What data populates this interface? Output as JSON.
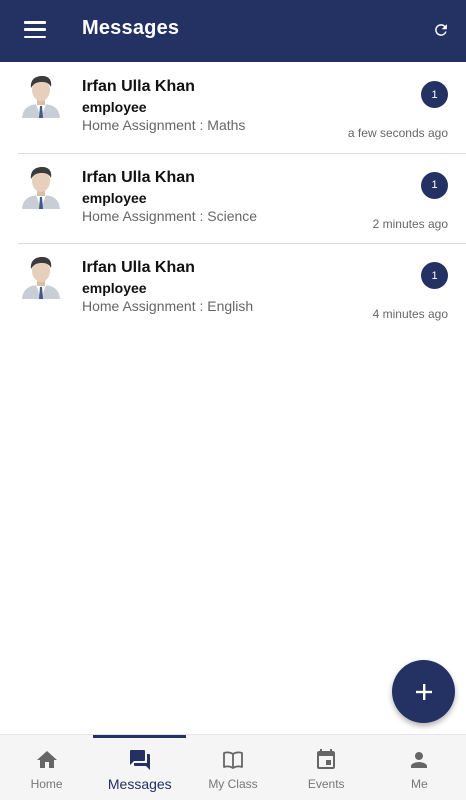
{
  "header": {
    "title": "Messages",
    "menu_icon": "menu-icon",
    "refresh_icon": "refresh-icon"
  },
  "colors": {
    "primary": "#233163",
    "badge": "#233163"
  },
  "messages": [
    {
      "name": "Irfan Ulla Khan",
      "role": "employee",
      "subject": "Home Assignment : Maths",
      "count": "1",
      "time": "a few seconds ago"
    },
    {
      "name": "Irfan Ulla Khan",
      "role": "employee",
      "subject": "Home Assignment : Science",
      "count": "1",
      "time": "2 minutes ago"
    },
    {
      "name": "Irfan Ulla Khan",
      "role": "employee",
      "subject": "Home Assignment : English",
      "count": "1",
      "time": "4 minutes ago"
    }
  ],
  "fab": {
    "icon": "plus-icon"
  },
  "nav": {
    "active": "Messages",
    "tabs": [
      {
        "label": "Home",
        "icon": "home-icon"
      },
      {
        "label": "Messages",
        "icon": "chat-icon"
      },
      {
        "label": "My Class",
        "icon": "book-icon"
      },
      {
        "label": "Events",
        "icon": "calendar-icon"
      },
      {
        "label": "Me",
        "icon": "person-icon"
      }
    ]
  }
}
